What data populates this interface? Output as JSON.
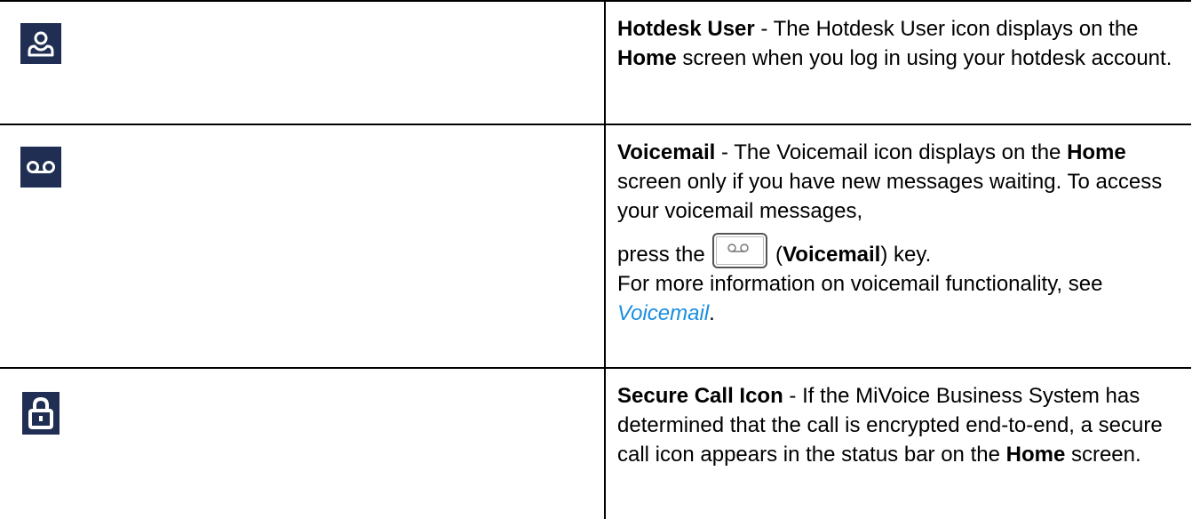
{
  "rows": [
    {
      "icon": "hotdesk-user-icon",
      "title": "Hotdesk User",
      "sep": " - ",
      "text_1": "The Hotdesk User icon displays on the ",
      "bold_1": "Home",
      "text_2": " screen when you log in using your hotdesk account."
    },
    {
      "icon": "voicemail-icon",
      "title": "Voicemail",
      "sep": " - ",
      "text_1": "The Voicemail icon displays on the ",
      "bold_1": "Home",
      "text_2": " screen only if you have new messages waiting. To access your voicemail messages,",
      "press_text": "press the ",
      "key_icon": "voicemail-key-icon",
      "key_open": " (",
      "key_label": "Voicemail",
      "key_close": ") key.",
      "more_info": "For more information on voicemail functionality, see ",
      "link_text": "Voicemail",
      "link_end": "."
    },
    {
      "icon": "lock-icon",
      "title": "Secure Call Icon",
      "sep": " - ",
      "text_1": "If the MiVoice Business System has determined that the call is encrypted end-to-end, a secure call icon appears in the status bar on the ",
      "bold_1": "Home",
      "text_2": " screen."
    }
  ],
  "colors": {
    "icon_bg": "#1f2e52",
    "icon_fg": "#ffffff",
    "link": "#1a8ee0",
    "border": "#000000"
  }
}
